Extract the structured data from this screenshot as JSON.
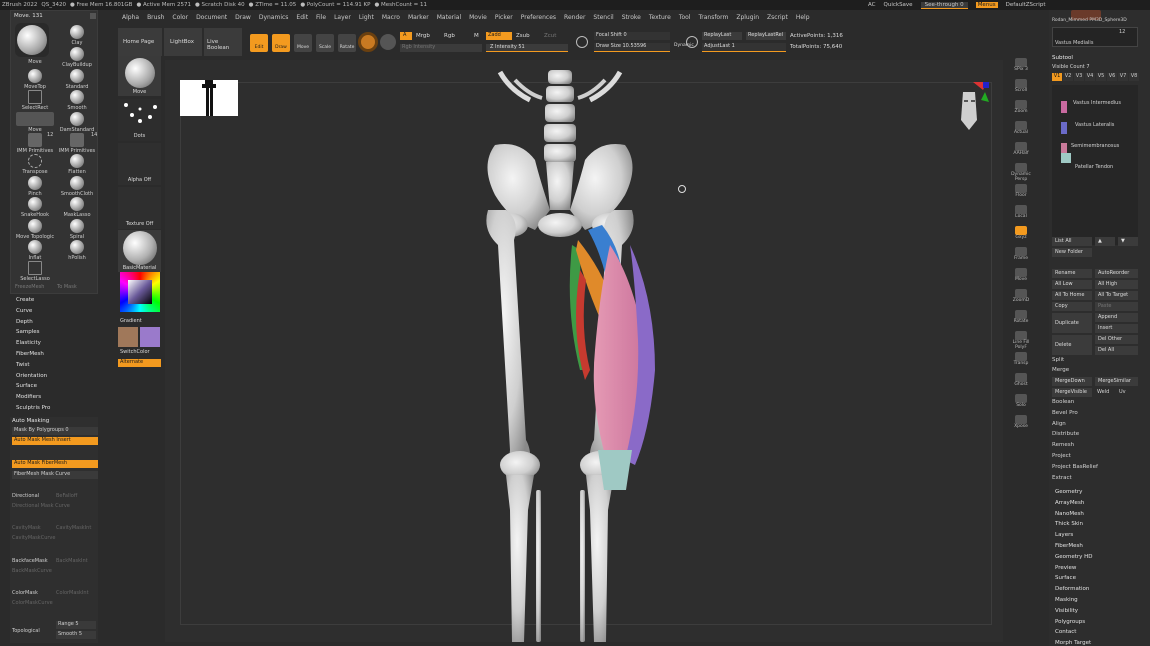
{
  "titlebar": {
    "app": "ZBrush 2022",
    "file": "QS_3420",
    "free_mem": "● Free Mem 16.801GB",
    "active_mem": "● Active Mem 2571",
    "scratch": "● Scratch Disk 40",
    "ztime": "● ZTime = 11.05",
    "polycount": "● PolyCount = 114.91 KP",
    "meshcount": "● MeshCount = 11"
  },
  "topright": {
    "ac": "AC",
    "quicksave": "QuickSave",
    "seethrough": "See-through 0",
    "menus": "Menus",
    "zscript": "DefaultZScript"
  },
  "menus": [
    "Alpha",
    "Brush",
    "Color",
    "Document",
    "Draw",
    "Dynamics",
    "Edit",
    "File",
    "Layer",
    "Light",
    "Macro",
    "Marker",
    "Material",
    "Movie",
    "Picker",
    "Preferences",
    "Render",
    "Stencil",
    "Stroke",
    "Texture",
    "Tool",
    "Transform",
    "Zplugin",
    "Zscript",
    "Help"
  ],
  "toolpanel": {
    "header": "Move. 131",
    "brushes": [
      {
        "label": "Move"
      },
      {
        "label": "Clay"
      },
      {
        "label": "ClayBuildup"
      },
      {
        "label": "MoveTop"
      },
      {
        "label": "Standard"
      },
      {
        "label": "SelectRect"
      },
      {
        "label": "Smooth"
      },
      {
        "label": "Move"
      },
      {
        "label": "DamStandard"
      },
      {
        "label": "IMM Primitives"
      },
      {
        "label": "IMM Primitives"
      },
      {
        "label": "Transpose"
      },
      {
        "label": "Flatten"
      },
      {
        "label": "Pinch"
      },
      {
        "label": "SmoothCloth"
      },
      {
        "label": "SnakeHook"
      },
      {
        "label": "MaskLasso"
      },
      {
        "label": "Move Topologic"
      },
      {
        "label": "Spiral"
      },
      {
        "label": "Inflat"
      },
      {
        "label": "hPolish"
      },
      {
        "label": "SelectLasso"
      }
    ],
    "footer_left": "FreezeMesh",
    "footer_right": "To Mask",
    "count_a": "12",
    "count_b": "14"
  },
  "leftlist": [
    "Create",
    "Curve",
    "Depth",
    "Samples",
    "Elasticity",
    "FiberMesh",
    "Twist",
    "Orientation",
    "Surface",
    "Modifiers",
    "Sculptris Pro"
  ],
  "mask": {
    "title": "Auto Masking",
    "by_polygroups": "Mask By Polygroups 0",
    "mesh_insert": "Auto Mask Mesh Insert",
    "fibermesh": "Auto Mask FiberMesh",
    "fibermesh_curve": "FiberMesh Mask Curve",
    "directional": "Directional",
    "dir_falloff": "BeFalloff",
    "dir_curve": "Directional Mask Curve",
    "cavity": "CavityMask",
    "cavity_mask": "CavityMaskInt",
    "cavity_curve": "CavityMaskCurve",
    "backface": "BackfaceMask",
    "backface_int": "BackMaskInt",
    "backface_curve": "BackMaskCurve",
    "color": "ColorMask",
    "color_int": "ColorMaskInt",
    "color_curve": "ColorMaskCurve",
    "topological": "Topological",
    "range": "Range 5",
    "smooth": "Smooth 5"
  },
  "col2": {
    "move_label": "Move",
    "dots_label": "Dots",
    "alpha_label": "Alpha Off",
    "texture_label": "Texture Off",
    "material_label": "BasicMaterial",
    "gradient_label": "Gradient",
    "switch_label": "SwitchColor",
    "alternate_label": "Alternate"
  },
  "shelf": {
    "home": "Home Page",
    "lightbox": "LightBox",
    "liveboolean": "Live Boolean",
    "edit": "Edit",
    "draw": "Draw",
    "move": "Move",
    "scale": "Scale",
    "rotate": "Rotate",
    "a_btn": "A",
    "mrgb": "Mrgb",
    "rgb": "Rgb",
    "m": "M",
    "rgb_intensity": "Rgb Intensity",
    "zadd": "Zadd",
    "zsub": "Zsub",
    "zcut": "Zcut",
    "z_intensity": "Z Intensity 51",
    "focal_shift": "Focal Shift 0",
    "draw_size": "Draw Size 10.53596",
    "dynamic": "Dynamic",
    "replay_last": "ReplayLast",
    "replay_last_rel": "ReplayLastRel",
    "adjust_last": "AdjustLast 1",
    "active_points": "ActivePoints: 1,316",
    "total_points": "TotalPoints: 75,640"
  },
  "rtool": [
    "SPix 3",
    "Scroll",
    "Zoom",
    "Actual",
    "AAHalf",
    "Dynamic Persp",
    "Floor",
    "Local",
    "Gxyz",
    "Frame",
    "Move",
    "ZoomD",
    "Rotate",
    "Line Fill PolyF",
    "Transp",
    "Ghost",
    "Solo",
    "Xpose"
  ],
  "rpanel": {
    "tool_title": "Rodan_Mimmed PM3D_Sphere3D",
    "count_box": "12",
    "current": "Vastus Medialis",
    "subtool": "Subtool",
    "visible_count": "Visible Count 7",
    "versions": [
      "V1",
      "V2",
      "V3",
      "V4",
      "V5",
      "V6",
      "V7",
      "V8"
    ],
    "subtools": [
      "Vastus Intermedius",
      "Vastus Lateralis",
      "Semimembranosus",
      "Patellar Tendon"
    ],
    "list_all": "List All",
    "new_folder": "New Folder",
    "rename": "Rename",
    "autoreorder": "AutoReorder",
    "all_low": "All Low",
    "all_high": "All High",
    "all_to_home": "All To Home",
    "all_to_target": "All To Target",
    "copy": "Copy",
    "paste": "Paste",
    "duplicate": "Duplicate",
    "append": "Append",
    "insert": "Insert",
    "delete": "Delete",
    "del_other": "Del Other",
    "del_all": "Del All",
    "split": "Split",
    "merge": "Merge",
    "merge_down": "MergeDown",
    "merge_similar": "MergeSimilar",
    "merge_visible": "MergeVisible",
    "weld": "Weld",
    "uv": "Uv",
    "boolean": "Boolean",
    "bevel_pro": "Bevel Pro",
    "align": "Align",
    "distribute": "Distribute",
    "remesh": "Remesh",
    "project": "Project",
    "project_bas": "Project BasRelief",
    "extract": "Extract",
    "sections": [
      "Geometry",
      "ArrayMesh",
      "NanoMesh",
      "Thick Skin",
      "Layers",
      "FiberMesh",
      "Geometry HD",
      "Preview",
      "Surface",
      "Deformation",
      "Masking",
      "Visibility",
      "Polygroups",
      "Contact",
      "Morph Target"
    ]
  },
  "colors": {
    "accent": "#f39a1f",
    "bg": "#2b2b2b",
    "panel": "#333333",
    "bone": "#d9d9d9",
    "muscle_pink": "#d77aa0",
    "muscle_blue": "#3a7fd0",
    "muscle_purple": "#8a6ac8",
    "muscle_green": "#3e9a45",
    "muscle_orange": "#e08a2a",
    "muscle_red": "#c63a2f"
  }
}
